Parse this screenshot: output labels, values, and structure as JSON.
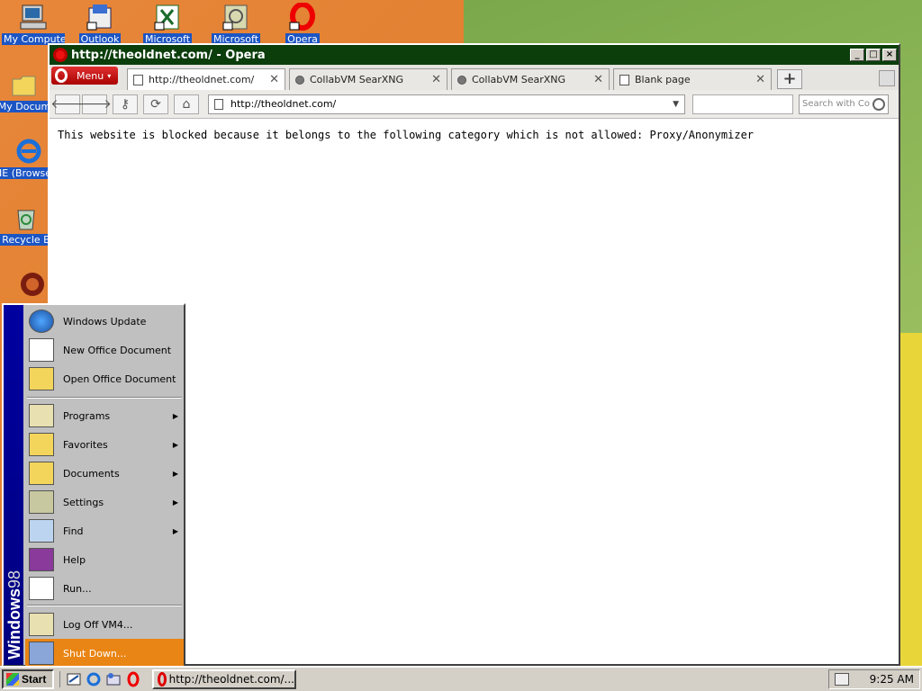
{
  "desktop": {
    "icons": [
      {
        "label": "My Computer",
        "icon": "computer-icon"
      },
      {
        "label": "Outlook",
        "icon": "outlook-icon"
      },
      {
        "label": "Microsoft",
        "icon": "excel-icon"
      },
      {
        "label": "Microsoft",
        "icon": "project-icon"
      },
      {
        "label": "Opera",
        "icon": "opera-icon"
      },
      {
        "label": "My Docum",
        "icon": "folder-icon"
      },
      {
        "label": "IE (Browserv",
        "icon": "ie-icon"
      },
      {
        "label": "Recycle B",
        "icon": "recycle-bin-icon"
      }
    ]
  },
  "window": {
    "title": "http://theoldnet.com/ - Opera",
    "menu_label": "Menu",
    "tabs": [
      {
        "label": "http://theoldnet.com/",
        "active": true
      },
      {
        "label": "CollabVM SearXNG",
        "active": false
      },
      {
        "label": "CollabVM SearXNG",
        "active": false
      },
      {
        "label": "Blank page",
        "active": false
      }
    ],
    "address": "http://theoldnet.com/",
    "search_placeholder": "Search with Co",
    "page_message": "This website is blocked because it belongs to the following category which is not allowed: Proxy/Anonymizer"
  },
  "start_menu": {
    "brand_windows": "Windows",
    "brand_98": "98",
    "items": [
      {
        "label": "Windows Update",
        "submenu": false,
        "icon": "windows-update-icon"
      },
      {
        "label": "New Office Document",
        "submenu": false,
        "icon": "new-office-doc-icon"
      },
      {
        "label": "Open Office Document",
        "submenu": false,
        "icon": "open-office-doc-icon"
      },
      {
        "label": "Programs",
        "submenu": true,
        "icon": "programs-icon"
      },
      {
        "label": "Favorites",
        "submenu": true,
        "icon": "favorites-icon"
      },
      {
        "label": "Documents",
        "submenu": true,
        "icon": "documents-icon"
      },
      {
        "label": "Settings",
        "submenu": true,
        "icon": "settings-icon"
      },
      {
        "label": "Find",
        "submenu": true,
        "icon": "find-icon"
      },
      {
        "label": "Help",
        "submenu": false,
        "icon": "help-icon"
      },
      {
        "label": "Run...",
        "submenu": false,
        "icon": "run-icon"
      },
      {
        "label": "Log Off VM4...",
        "submenu": false,
        "icon": "log-off-icon"
      },
      {
        "label": "Shut Down...",
        "submenu": false,
        "icon": "shut-down-icon",
        "selected": true
      }
    ]
  },
  "taskbar": {
    "start_label": "Start",
    "task_label": "http://theoldnet.com/...",
    "clock": "9:25 AM"
  },
  "colors": {
    "selection": "#e98515",
    "start_menu_side": "#000080"
  }
}
